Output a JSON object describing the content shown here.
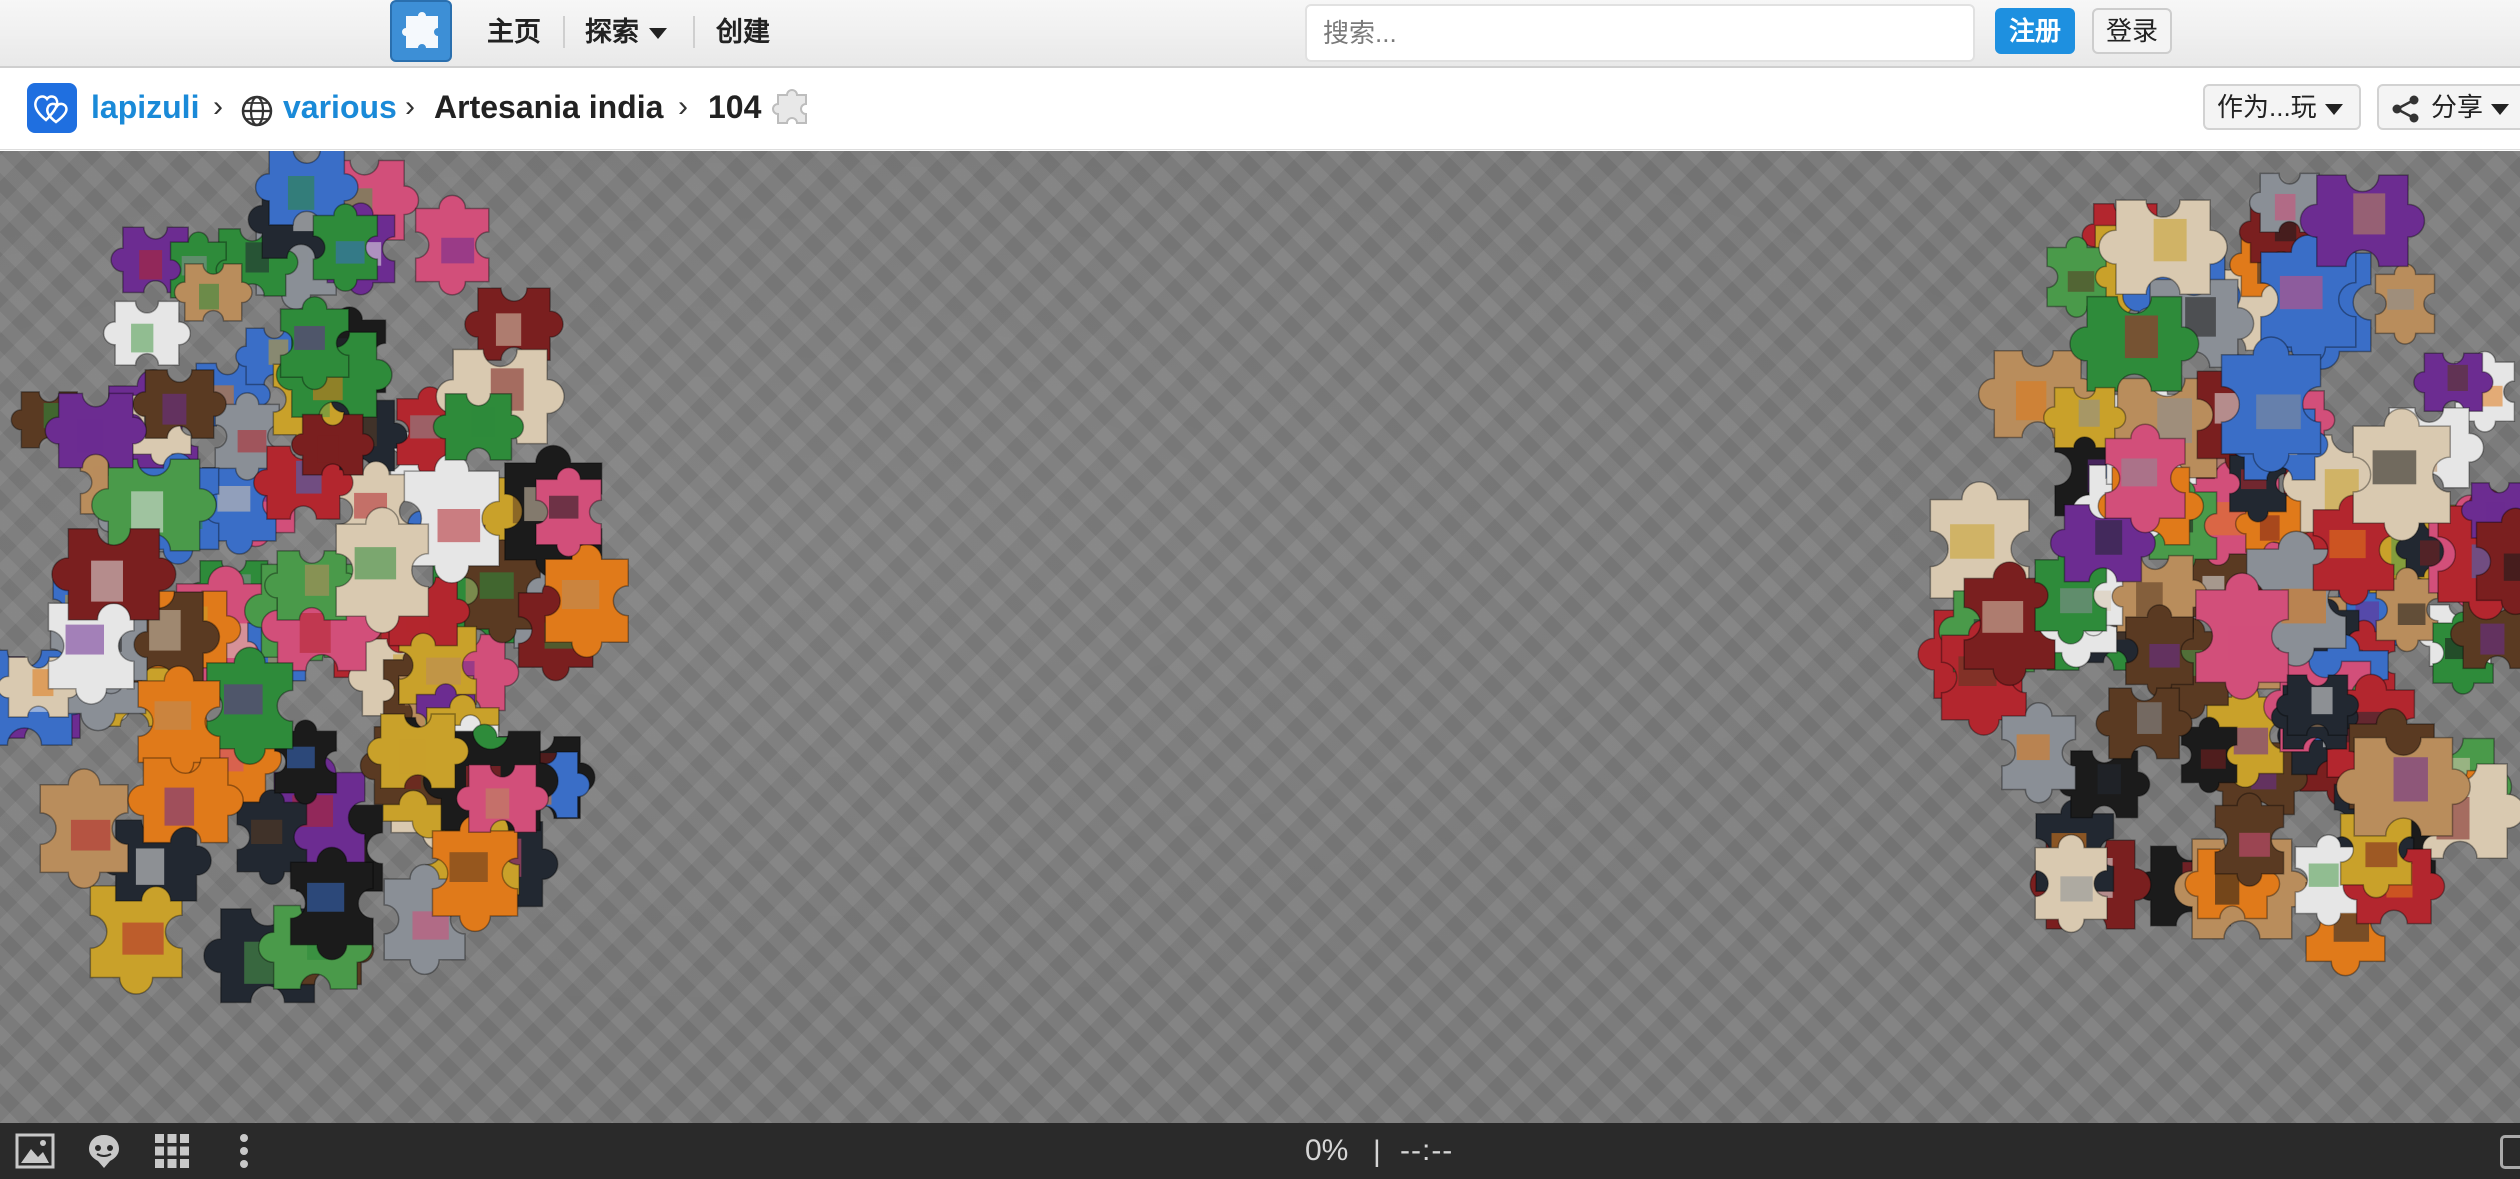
{
  "nav": {
    "home": "主页",
    "explore": "探索",
    "create": "创建",
    "search_placeholder": "搜索...",
    "register": "注册",
    "login": "登录"
  },
  "breadcrumb": {
    "user": "lapizuli",
    "category": "various",
    "puzzle_name": "Artesania india",
    "piece_count": "104"
  },
  "actions": {
    "play_as": "作为...玩",
    "share": "分享"
  },
  "status": {
    "progress": "0%",
    "separator": "|",
    "timer": "--:--"
  },
  "icons": {
    "logo": "puzzle-logo-icon",
    "avatar": "heart-avatar-icon",
    "globe": "globe-icon",
    "pieces": "puzzle-piece-icon",
    "share": "share-icon",
    "image": "image-icon",
    "ghost": "ghost-icon",
    "grid": "grid-icon",
    "more": "more-icon",
    "fullscreen": "fullscreen-icon"
  },
  "colors": {
    "accent": "#1e90e0",
    "board": "#7b7b7b",
    "bottombar": "#2a2a2a"
  }
}
